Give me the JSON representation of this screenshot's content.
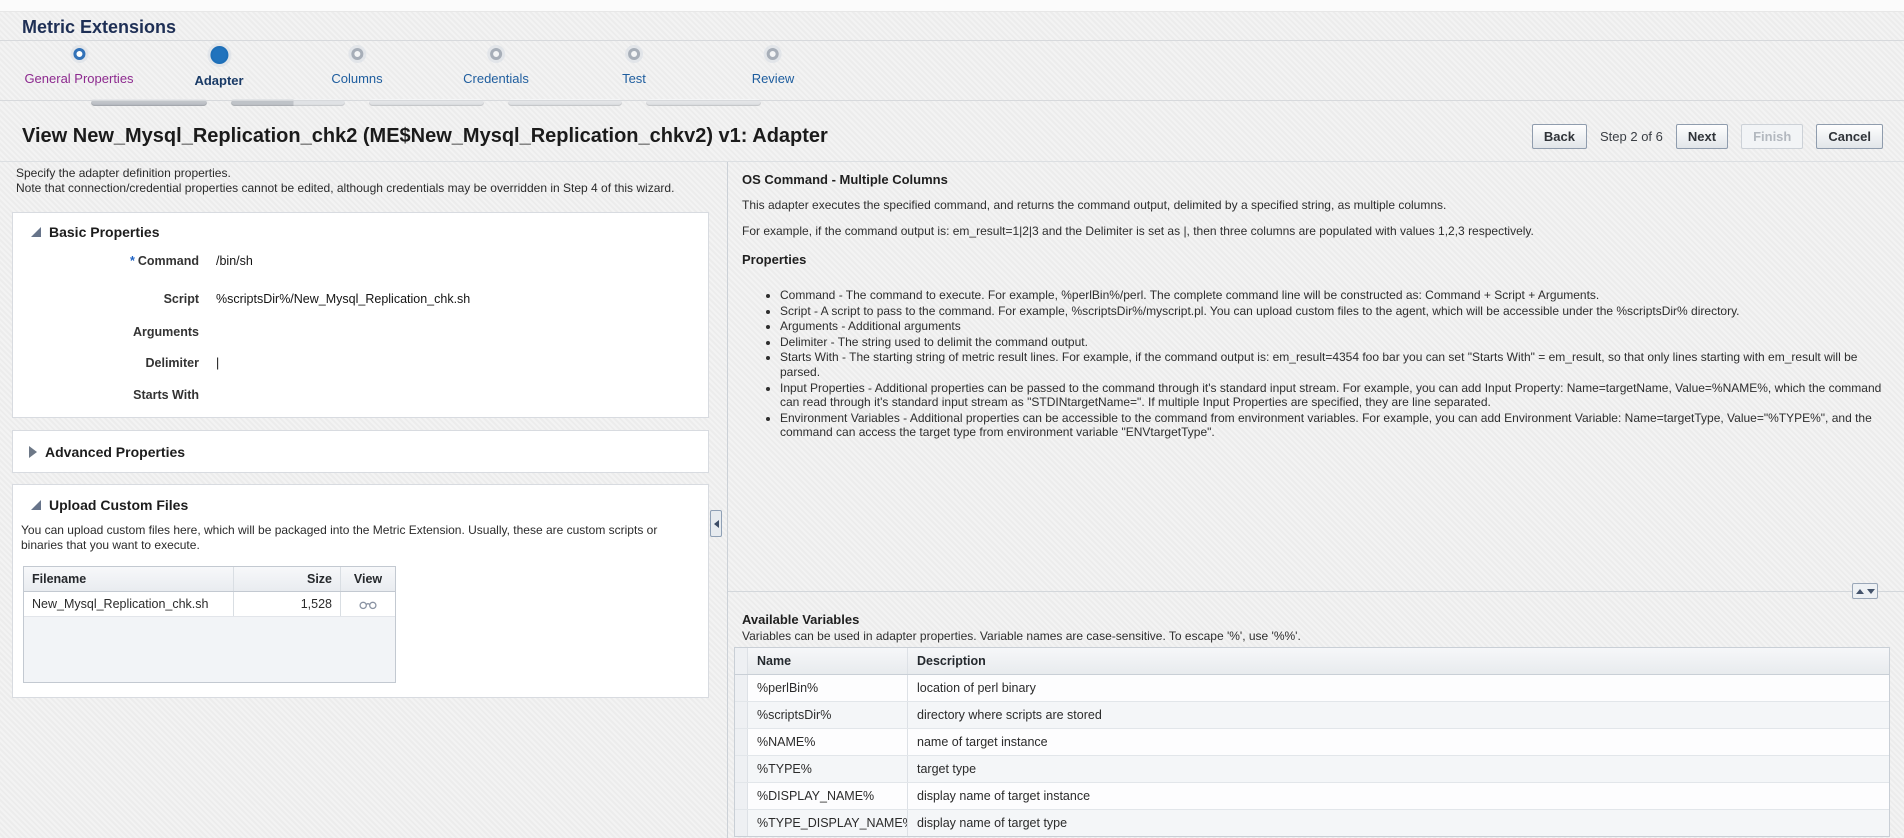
{
  "app_title": "Metric Extensions",
  "train": {
    "steps": [
      {
        "label": "General Properties",
        "state": "visited"
      },
      {
        "label": "Adapter",
        "state": "current"
      },
      {
        "label": "Columns",
        "state": "future"
      },
      {
        "label": "Credentials",
        "state": "future"
      },
      {
        "label": "Test",
        "state": "future"
      },
      {
        "label": "Review",
        "state": "future"
      }
    ]
  },
  "header": {
    "title": "View New_Mysql_Replication_chk2 (ME$New_Mysql_Replication_chkv2) v1: Adapter",
    "step_indicator": "Step 2 of 6",
    "back_label": "Back",
    "next_label": "Next",
    "finish_label": "Finish",
    "cancel_label": "Cancel"
  },
  "left": {
    "intro_line1": "Specify the adapter definition properties.",
    "intro_line2": "Note that connection/credential properties cannot be edited, although credentials may be overridden in Step 4 of this wizard.",
    "basic": {
      "title": "Basic Properties",
      "fields": [
        {
          "label": "Command",
          "value": "/bin/sh"
        },
        {
          "label": "Script",
          "value": "%scriptsDir%/New_Mysql_Replication_chk.sh"
        },
        {
          "label": "Arguments",
          "value": ""
        },
        {
          "label": "Delimiter",
          "value": "|"
        },
        {
          "label": "Starts With",
          "value": ""
        }
      ]
    },
    "advanced": {
      "title": "Advanced Properties"
    },
    "upload": {
      "title": "Upload Custom Files",
      "description": "You can upload custom files here, which will be packaged into the Metric Extension. Usually, these are custom scripts or binaries that you want to execute.",
      "headers": {
        "filename": "Filename",
        "size": "Size",
        "view": "View"
      },
      "rows": [
        {
          "filename": "New_Mysql_Replication_chk.sh",
          "size": "1,528"
        }
      ]
    }
  },
  "right": {
    "help": {
      "title": "OS Command - Multiple Columns",
      "para1": "This adapter executes the specified command, and returns the command output, delimited by a specified string, as multiple columns.",
      "para2": "For example, if the command output is: em_result=1|2|3 and the Delimiter is set as |, then three columns are populated with values 1,2,3 respectively.",
      "properties_title": "Properties",
      "bullets": [
        "Command - The command to execute. For example, %perlBin%/perl. The complete command line will be constructed as: Command + Script + Arguments.",
        "Script - A script to pass to the command. For example, %scriptsDir%/myscript.pl. You can upload custom files to the agent, which will be accessible under the %scriptsDir% directory.",
        "Arguments - Additional arguments",
        "Delimiter - The string used to delimit the command output.",
        "Starts With - The starting string of metric result lines. For example, if the command output is: em_result=4354 foo bar you can set \"Starts With\" = em_result, so that only lines starting with em_result will be parsed.",
        "Input Properties - Additional properties can be passed to the command through it's standard input stream. For example, you can add Input Property: Name=targetName, Value=%NAME%, which the command can read through it's standard input stream as \"STDINtargetName=\". If multiple Input Properties are specified, they are line separated.",
        "Environment Variables - Additional properties can be accessible to the command from environment variables. For example, you can add Environment Variable: Name=targetType, Value=\"%TYPE%\", and the command can access the target type from environment variable \"ENVtargetType\"."
      ]
    },
    "variables": {
      "title": "Available Variables",
      "subtitle": "Variables can be used in adapter properties. Variable names are case-sensitive. To escape '%', use '%%'.",
      "headers": {
        "name": "Name",
        "description": "Description"
      },
      "rows": [
        {
          "name": "%perlBin%",
          "desc": "location of perl binary"
        },
        {
          "name": "%scriptsDir%",
          "desc": "directory where scripts are stored"
        },
        {
          "name": "%NAME%",
          "desc": "name of target instance"
        },
        {
          "name": "%TYPE%",
          "desc": "target type"
        },
        {
          "name": "%DISPLAY_NAME%",
          "desc": "display name of target instance"
        },
        {
          "name": "%TYPE_DISPLAY_NAME%",
          "desc": "display name of target type"
        }
      ]
    }
  },
  "colors": {
    "accent_blue": "#2173bd",
    "visited_purple": "#8d2a8f",
    "link_blue": "#1e5d9e",
    "title_navy": "#1e2f55"
  }
}
